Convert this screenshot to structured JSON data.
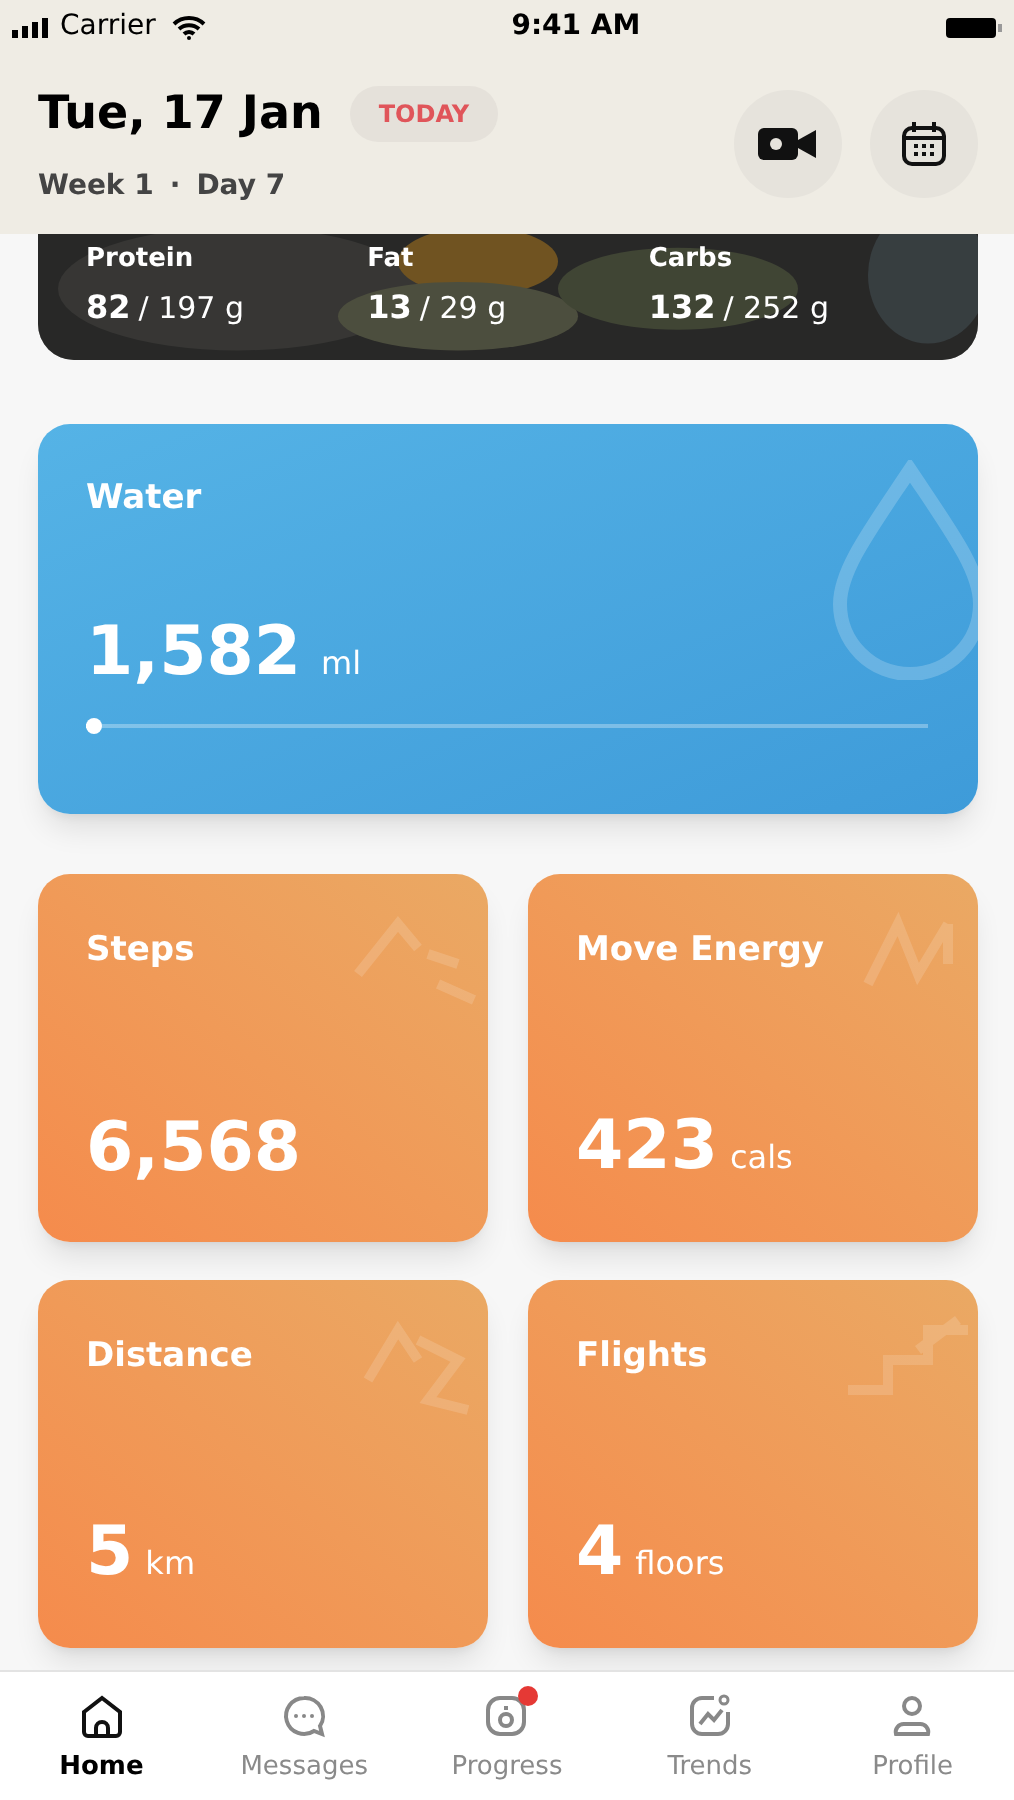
{
  "status_bar": {
    "carrier": "Carrier",
    "time": "9:41 AM"
  },
  "header": {
    "date": "Tue, 17 Jan",
    "badge": "TODAY",
    "week": "Week 1",
    "separator": "·",
    "day": "Day 7"
  },
  "nutrition": [
    {
      "label": "Protein",
      "value": "82",
      "target": "/ 197 g"
    },
    {
      "label": "Fat",
      "value": "13",
      "target": "/ 29 g"
    },
    {
      "label": "Carbs",
      "value": "132",
      "target": "/ 252 g"
    }
  ],
  "water": {
    "title": "Water",
    "value": "1,582",
    "unit": "ml",
    "level": 0.01
  },
  "metrics": [
    {
      "kind": "steps",
      "title": "Steps",
      "value": "6,568"
    },
    {
      "kind": "energy",
      "title": "Move Energy",
      "value": "423",
      "unit": "cals"
    },
    {
      "kind": "distance",
      "title": "Distance",
      "value": "5",
      "unit": "km"
    },
    {
      "kind": "flights",
      "title": "Flights",
      "value": "4",
      "unit": "floors"
    }
  ],
  "tabs": [
    {
      "kind": "home",
      "label": "Home",
      "selected": true,
      "badge": false
    },
    {
      "kind": "messages",
      "label": "Messages",
      "selected": false,
      "badge": false
    },
    {
      "kind": "progress",
      "label": "Progress",
      "selected": false,
      "badge": true
    },
    {
      "kind": "trends",
      "label": "Trends",
      "selected": false,
      "badge": false
    },
    {
      "kind": "profile",
      "label": "Profile",
      "selected": false,
      "badge": false
    }
  ]
}
